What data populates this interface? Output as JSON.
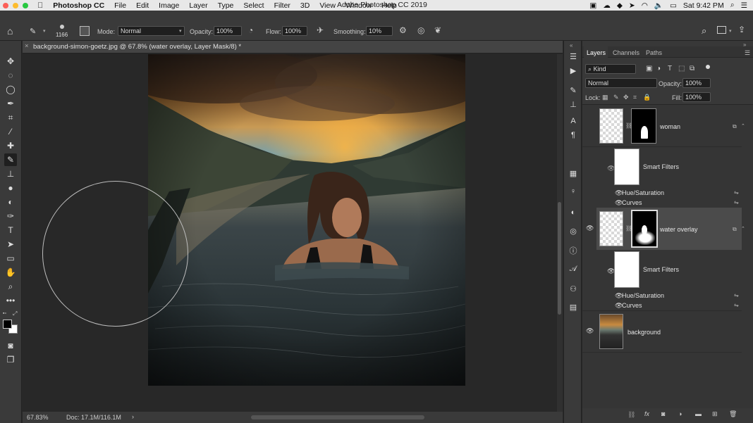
{
  "menubar": {
    "apple": "",
    "app": "Photoshop CC",
    "items": [
      "File",
      "Edit",
      "Image",
      "Layer",
      "Type",
      "Select",
      "Filter",
      "3D",
      "View",
      "Window",
      "Help"
    ],
    "window_title": "Adobe Photoshop CC 2019",
    "clock": "Sat 9:42 PM"
  },
  "options": {
    "brush_size": "1166",
    "mode_label": "Mode:",
    "mode_value": "Normal",
    "opacity_label": "Opacity:",
    "opacity_value": "100%",
    "flow_label": "Flow:",
    "flow_value": "100%",
    "smoothing_label": "Smoothing:",
    "smoothing_value": "10%"
  },
  "document": {
    "tab_title": "background-simon-goetz.jpg @ 67.8% (water overlay, Layer Mask/8) *",
    "close": "×"
  },
  "status": {
    "zoom": "67.83%",
    "doc": "Doc: 17.1M/116.1M",
    "arrow": "›"
  },
  "panel": {
    "tabs": [
      "Layers",
      "Channels",
      "Paths"
    ],
    "filter_kind": "Kind",
    "blend_mode": "Normal",
    "opacity_label": "Opacity:",
    "opacity_value": "100%",
    "lock_label": "Lock:",
    "fill_label": "Fill:",
    "fill_value": "100%"
  },
  "layers": [
    {
      "name": "woman",
      "smart_filters": "Smart Filters",
      "filters": [
        "Hue/Saturation",
        "Curves"
      ]
    },
    {
      "name": "water overlay",
      "smart_filters": "Smart Filters",
      "filters": [
        "Hue/Saturation",
        "Curves"
      ]
    },
    {
      "name": "background"
    }
  ],
  "colors": {
    "menubar": "#e8e8e8",
    "panel": "#383838",
    "selected_layer": "#4b4b4b",
    "canvas_bg": "#282828"
  }
}
